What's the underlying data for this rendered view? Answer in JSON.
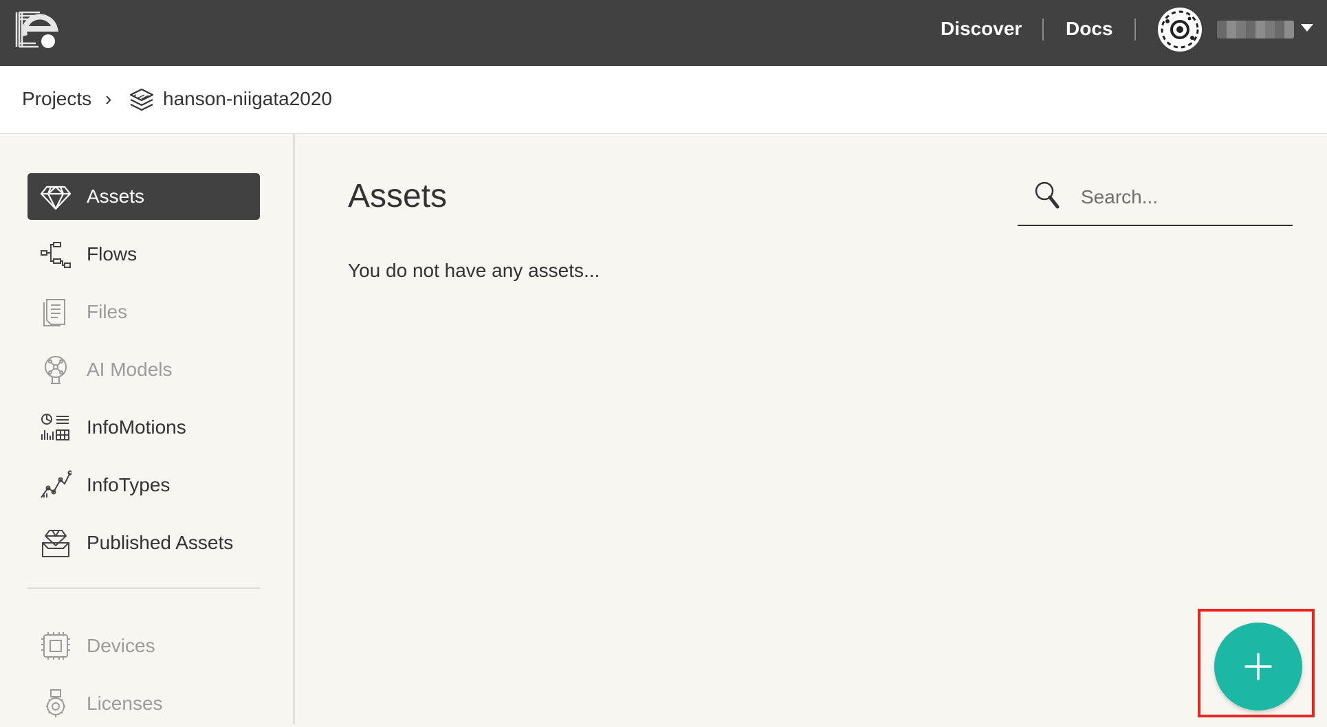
{
  "topbar": {
    "nav": [
      {
        "label": "Discover"
      },
      {
        "label": "Docs"
      }
    ],
    "user_menu_icon": "chevron-down-icon"
  },
  "breadcrumb": {
    "root": "Projects",
    "separator": "›",
    "project": "hanson-niigata2020",
    "project_icon": "layers-icon"
  },
  "sidebar": {
    "items": [
      {
        "label": "Assets",
        "icon": "diamond-icon",
        "state": "active"
      },
      {
        "label": "Flows",
        "icon": "flow-icon",
        "state": "enabled"
      },
      {
        "label": "Files",
        "icon": "file-icon",
        "state": "disabled"
      },
      {
        "label": "AI Models",
        "icon": "ai-model-icon",
        "state": "disabled"
      },
      {
        "label": "InfoMotions",
        "icon": "infomotions-icon",
        "state": "enabled"
      },
      {
        "label": "InfoTypes",
        "icon": "infotypes-icon",
        "state": "enabled"
      },
      {
        "label": "Published Assets",
        "icon": "published-assets-icon",
        "state": "enabled"
      }
    ],
    "bottom_items": [
      {
        "label": "Devices",
        "icon": "device-icon",
        "state": "disabled"
      },
      {
        "label": "Licenses",
        "icon": "license-icon",
        "state": "disabled"
      }
    ]
  },
  "main": {
    "title": "Assets",
    "empty_message": "You do not have any assets...",
    "search": {
      "placeholder": "Search...",
      "value": ""
    }
  },
  "fab": {
    "icon": "plus-icon"
  },
  "colors": {
    "topbar": "#414141",
    "accent": "#1db8a5",
    "highlight": "#e8261f",
    "background": "#f7f6f1"
  }
}
